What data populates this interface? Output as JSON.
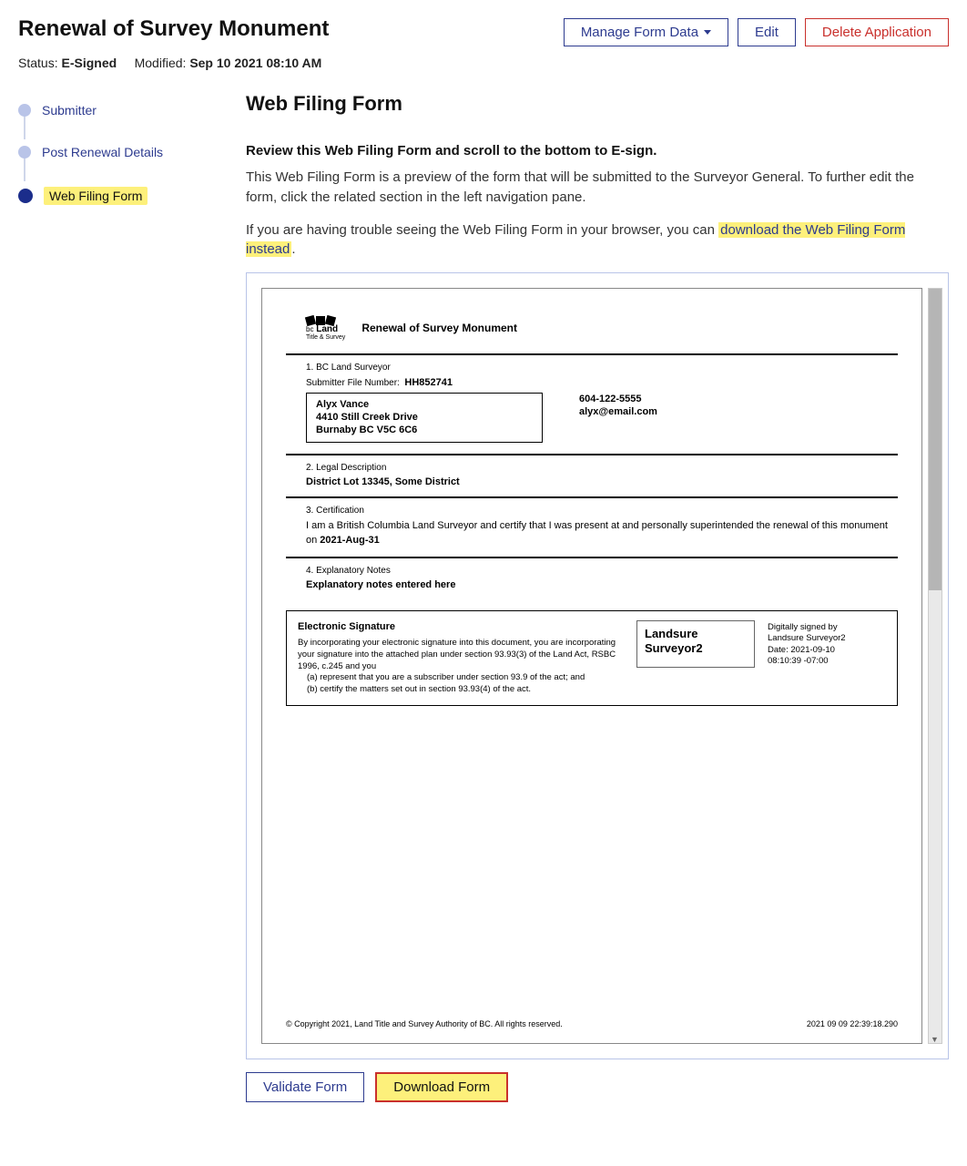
{
  "header": {
    "title": "Renewal of Survey Monument",
    "buttons": {
      "manage": "Manage Form Data",
      "edit": "Edit",
      "delete": "Delete Application"
    },
    "status_label": "Status:",
    "status_value": "E-Signed",
    "modified_label": "Modified:",
    "modified_value": "Sep 10 2021 08:10 AM"
  },
  "sidebar": {
    "items": [
      {
        "label": "Submitter"
      },
      {
        "label": "Post Renewal Details"
      },
      {
        "label": "Web Filing Form"
      }
    ]
  },
  "main": {
    "heading": "Web Filing Form",
    "review": "Review this Web Filing Form and scroll to the bottom to E-sign.",
    "desc": "This Web Filing Form is a preview of the form that will be submitted to the Surveyor General. To further edit the form, click the related section in the left navigation pane.",
    "trouble_prefix": "If you are having trouble seeing the Web Filing Form in your browser, you can ",
    "trouble_link": "download the Web Filing Form instead",
    "dot": "."
  },
  "pdf": {
    "logo": {
      "line1_a": "bc",
      "line1_b": "Land",
      "line2": "Title & Survey"
    },
    "title": "Renewal of Survey Monument",
    "s1": {
      "heading": "1. BC Land Surveyor",
      "file_label": "Submitter File Number:",
      "file_value": "HH852741",
      "name": "Alyx Vance",
      "addr1": "4410 Still Creek Drive",
      "addr2": "Burnaby BC V5C 6C6",
      "phone": "604-122-5555",
      "email": "alyx@email.com"
    },
    "s2": {
      "heading": "2. Legal Description",
      "value": "District Lot 13345, Some District"
    },
    "s3": {
      "heading": "3. Certification",
      "text_a": "I am a British Columbia Land Surveyor and certify that I was present at and personally superintended the renewal of this monument on ",
      "date": "2021-Aug-31"
    },
    "s4": {
      "heading": "4. Explanatory Notes",
      "value": "Explanatory notes entered here"
    },
    "sig": {
      "title": "Electronic Signature",
      "body": "By incorporating your electronic signature into this document, you are incorporating your signature into the attached plan under section 93.93(3) of the Land Act, RSBC 1996, c.245 and you",
      "a": "(a)    represent that you are a subscriber under section 93.9 of the act; and",
      "b": "(b)    certify the matters set out in section 93.93(4) of the act.",
      "signer1": "Landsure",
      "signer2": "Surveyor2",
      "right1": "Digitally signed by",
      "right2": "Landsure Surveyor2",
      "right3": "Date: 2021-09-10",
      "right4": "08:10:39 -07:00"
    },
    "footer": {
      "copyright": "© Copyright 2021, Land Title and Survey Authority of BC. All rights reserved.",
      "timestamp": "2021 09 09 22:39:18.290"
    }
  },
  "actions": {
    "validate": "Validate Form",
    "download": "Download Form"
  }
}
